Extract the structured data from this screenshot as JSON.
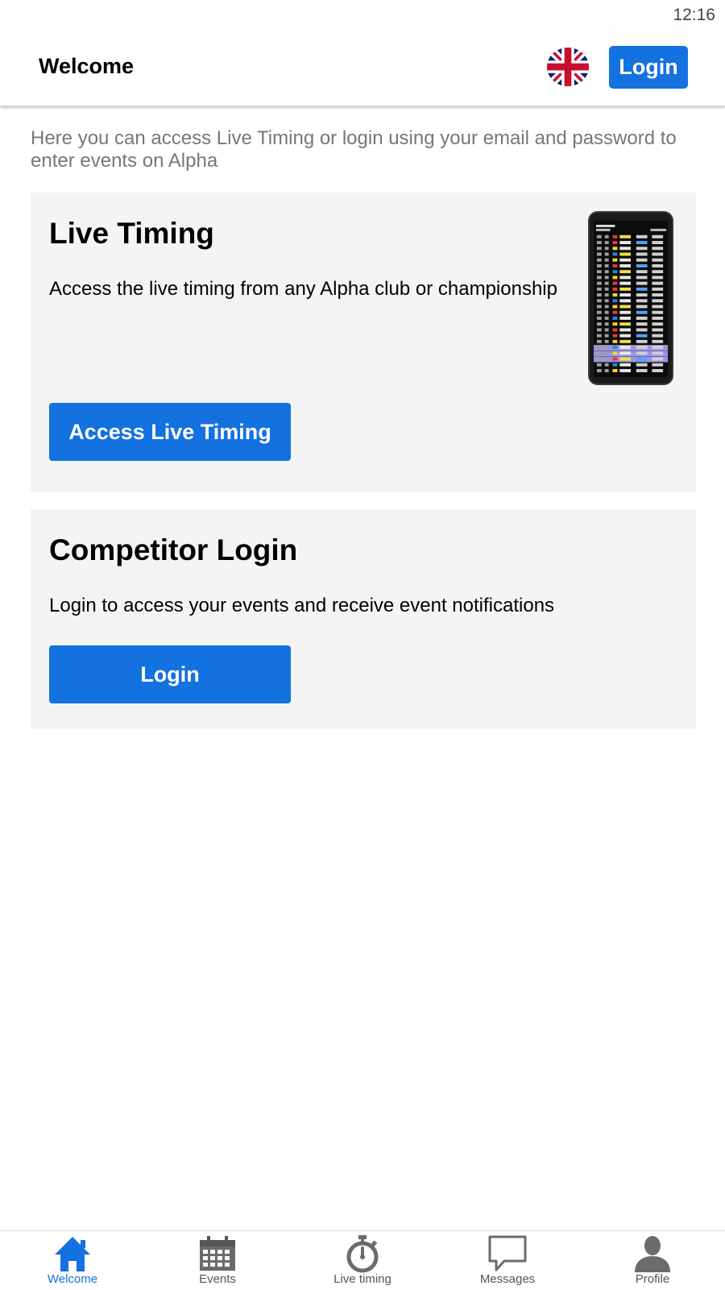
{
  "status_bar": {
    "time": "12:16"
  },
  "header": {
    "title": "Welcome",
    "language_icon": "uk-flag-icon",
    "login_label": "Login"
  },
  "intro": "Here you can access Live Timing or login using your email and password to enter events on Alpha",
  "live_timing_card": {
    "title": "Live Timing",
    "description": "Access the live timing from any Alpha club or championship",
    "button_label": "Access Live Timing",
    "image": "phone-live-timing-screenshot"
  },
  "login_card": {
    "title": "Competitor Login",
    "description": "Login to access your events and receive event notifications",
    "button_label": "Login"
  },
  "bottom_nav": {
    "items": [
      {
        "label": "Welcome",
        "icon": "home-icon",
        "active": true
      },
      {
        "label": "Events",
        "icon": "calendar-icon",
        "active": false
      },
      {
        "label": "Live timing",
        "icon": "stopwatch-icon",
        "active": false
      },
      {
        "label": "Messages",
        "icon": "message-icon",
        "active": false
      },
      {
        "label": "Profile",
        "icon": "person-icon",
        "active": false
      }
    ]
  },
  "colors": {
    "accent": "#1471e0",
    "card_background": "#f4f4f4",
    "muted_text": "#777777",
    "nav_inactive": "#555555"
  }
}
